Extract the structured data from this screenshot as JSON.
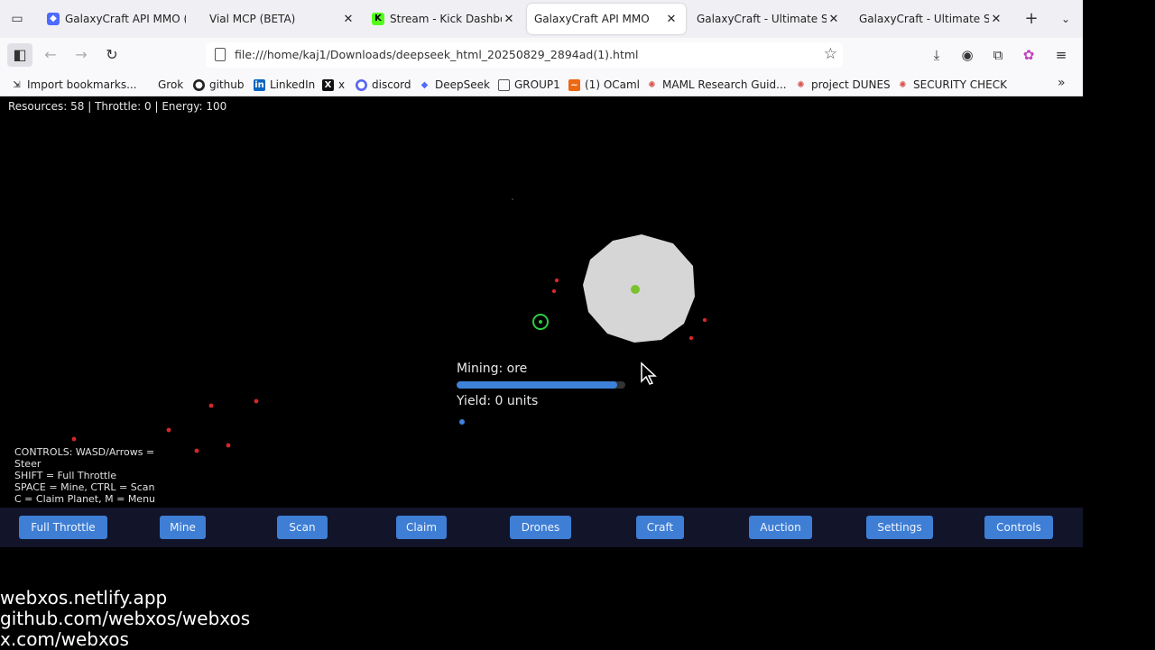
{
  "browser": {
    "tabs": [
      {
        "title": "GalaxyCraft API MMO (",
        "favicon": "deepseek-icon",
        "favcolor": "#4d6bfe",
        "active": false
      },
      {
        "title": "Vial MCP (BETA)",
        "favicon": "none",
        "favcolor": "",
        "active": false
      },
      {
        "title": "Stream - Kick Dashboar",
        "favicon": "kick-icon",
        "favcolor": "#53fc18",
        "active": false
      },
      {
        "title": "GalaxyCraft API MMO",
        "favicon": "none",
        "favcolor": "",
        "active": true
      },
      {
        "title": "GalaxyCraft - Ultimate Spa",
        "favicon": "none",
        "favcolor": "",
        "active": false
      },
      {
        "title": "GalaxyCraft - Ultimate Spa",
        "favicon": "none",
        "favcolor": "",
        "active": false
      }
    ],
    "url": "file:///home/kaj1/Downloads/deepseek_html_20250829_2894ad(1).html",
    "bookmarks": [
      {
        "label": "Import bookmarks...",
        "icon": "import-icon"
      },
      {
        "label": "Grok",
        "icon": "none"
      },
      {
        "label": "github",
        "icon": "github-icon"
      },
      {
        "label": "LinkedIn",
        "icon": "linkedin-icon"
      },
      {
        "label": "x",
        "icon": "x-icon"
      },
      {
        "label": "discord",
        "icon": "discord-icon"
      },
      {
        "label": "DeepSeek",
        "icon": "deepseek-icon"
      },
      {
        "label": "GROUP1",
        "icon": "page-icon"
      },
      {
        "label": "(1) OCaml",
        "icon": "ocaml-icon"
      },
      {
        "label": "MAML Research Guid...",
        "icon": "spark-icon"
      },
      {
        "label": "project DUNES",
        "icon": "spark-icon"
      },
      {
        "label": "SECURITY CHECK",
        "icon": "spark-icon"
      }
    ]
  },
  "game": {
    "hud": "Resources: 58 | Throttle: 0 | Energy: 100",
    "mining_label": "Mining: ore",
    "mining_progress": 0.95,
    "yield_label": "Yield: 0 units",
    "controls": [
      "CONTROLS: WASD/Arrows =",
      "Steer",
      "SHIFT = Full Throttle",
      "SPACE = Mine, CTRL = Scan",
      "C = Claim Planet, M = Menu"
    ],
    "actions": [
      "Full Throttle",
      "Mine",
      "Scan",
      "Claim",
      "Drones",
      "Craft",
      "Auction",
      "Settings",
      "Controls"
    ],
    "colors": {
      "planet": "#d6d6d6",
      "core": "#7cc12f",
      "ship": "#2ecc40",
      "enemy": "#d42828",
      "button": "#3e7ed4",
      "bar": "#12142a"
    }
  },
  "overlay": {
    "lines": [
      "webxos.netlify.app",
      "github.com/webxos/webxos",
      "x.com/webxos"
    ]
  }
}
